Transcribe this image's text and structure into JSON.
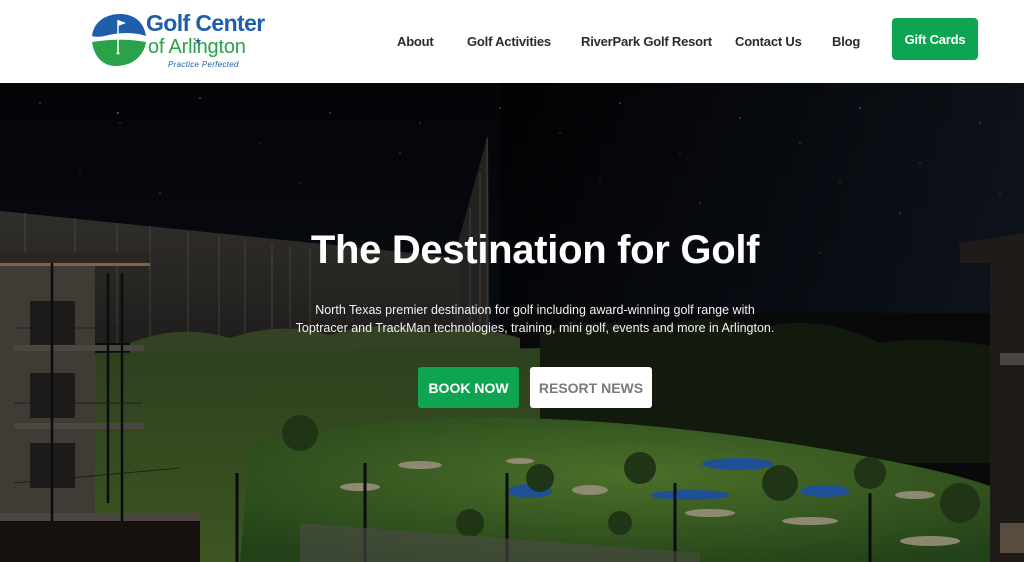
{
  "header": {
    "logo": {
      "line1": "Golf Center",
      "line2": "of Arlington",
      "tagline": "Practice Perfected",
      "star": "★"
    },
    "nav": [
      {
        "label": "About"
      },
      {
        "label": "Golf Activities"
      },
      {
        "label": "RiverPark Golf Resort"
      },
      {
        "label": "Contact Us"
      },
      {
        "label": "Blog"
      }
    ],
    "cta_label": "Gift Cards"
  },
  "hero": {
    "title": "The Destination for Golf",
    "description_line1": "North Texas premier destination for golf including award-winning golf range with",
    "description_line2": "Toptracer and TrackMan technologies, training, mini golf, events and more in Arlington.",
    "primary_button": "BOOK NOW",
    "secondary_button": "RESORT NEWS"
  },
  "colors": {
    "brand_blue": "#1f5eab",
    "brand_green": "#29a24a",
    "button_green": "#0fa451"
  }
}
